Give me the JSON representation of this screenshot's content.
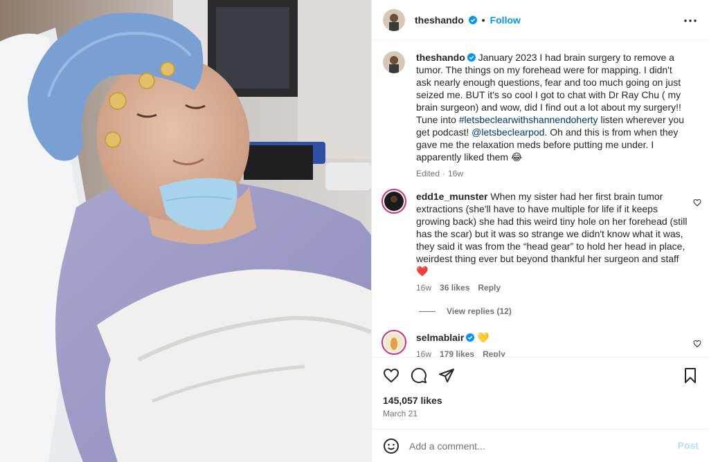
{
  "post": {
    "author": "theshando",
    "follow_label": "Follow",
    "dot": "•",
    "caption_parts": {
      "before_tag": " January 2023 I had brain surgery to remove a tumor. The things on my forehead were for mapping. I didn't ask nearly enough questions, fear and too much going on just seized me. BUT it's so cool I got to chat with Dr Ray Chu ( my brain surgeon) and wow, did I find out a lot about my surgery!! Tune into ",
      "hashtag": "#letsbeclearwithshannendoherty",
      "middle": " listen wherever you get podcast! ",
      "mention": "@letsbeclearpod",
      "after": ". Oh and this is from when they gave me the relaxation meds before putting me under. I apparently liked them 😂"
    },
    "edited_label": "Edited",
    "edited_time": "16w",
    "likes_count": "145,057 likes",
    "date": "March 21"
  },
  "comments": [
    {
      "username": "edd1e_munster",
      "text": " When my sister had her first brain tumor extractions (she'll have to have multiple for life if it keeps growing back) she had this weird tiny hole on her forehead (still has the scar) but it was so strange we didn't know what it was, they said it was from the “head gear” to hold her head in place, weirdest thing ever but beyond thankful her surgeon and staff ❤️",
      "time": "16w",
      "likes": "36 likes",
      "reply_label": "Reply",
      "view_replies": "View replies (12)"
    },
    {
      "username": "selmablair",
      "text": " 💛",
      "time": "16w",
      "likes": "179 likes",
      "reply_label": "Reply"
    }
  ],
  "composer": {
    "placeholder": "Add a comment...",
    "post_label": "Post"
  },
  "icons": {
    "more": "more-horizontal-icon",
    "like": "heart-icon",
    "comment": "comment-icon",
    "share": "share-icon",
    "save": "bookmark-icon",
    "emoji": "emoji-icon",
    "verified": "verified-badge-icon"
  },
  "colors": {
    "accent": "#0095f6",
    "link": "#00376b",
    "muted": "#737373",
    "verified": "#0095f6",
    "heart_red": "#ed4956"
  }
}
